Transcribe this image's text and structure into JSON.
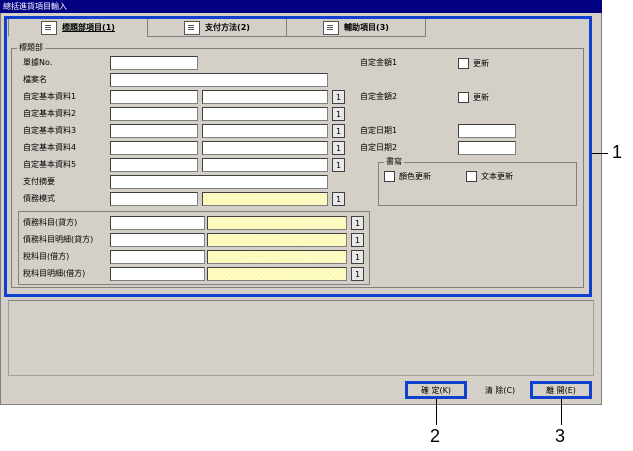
{
  "window": {
    "title": "總括進貨項目輸入"
  },
  "tabs": [
    {
      "label": "標題部項目(1)",
      "icon": "book-icon"
    },
    {
      "label": "支付方法(2)",
      "icon": "document-icon"
    },
    {
      "label": "輔助項目(3)",
      "icon": "screen-icon"
    }
  ],
  "header_group": {
    "title": "標題部"
  },
  "fields": {
    "bill_no": "單據No.",
    "file_name": "檔案名",
    "custom1": "自定基本資料1",
    "custom2": "自定基本資料2",
    "custom3": "自定基本資料3",
    "custom4": "自定基本資料4",
    "custom5": "自定基本資料5",
    "pay_summary": "支付摘要",
    "debt_mode": "債務模式"
  },
  "lookup_button": "1",
  "right_panel": {
    "amount1": "自定金額1",
    "amount2": "自定金額2",
    "date1": "自定日期1",
    "date2": "自定日期2",
    "update": "更新"
  },
  "write_group": {
    "title": "書寫",
    "color_update": "顏色更新",
    "text_update": "文本更新"
  },
  "accounts": {
    "debt_account": "債務科目(貸方)",
    "debt_detail": "債務科目明細(貸方)",
    "tax_account": "稅科目(借方)",
    "tax_detail": "稅科目明細(借方)"
  },
  "buttons": {
    "confirm": "確 定(K)",
    "clear": "清 除(C)",
    "close": "離 開(E)"
  },
  "callouts": [
    "1",
    "2",
    "3"
  ],
  "colors": {
    "highlight": "#1040d0",
    "title_bar": "#000080"
  }
}
